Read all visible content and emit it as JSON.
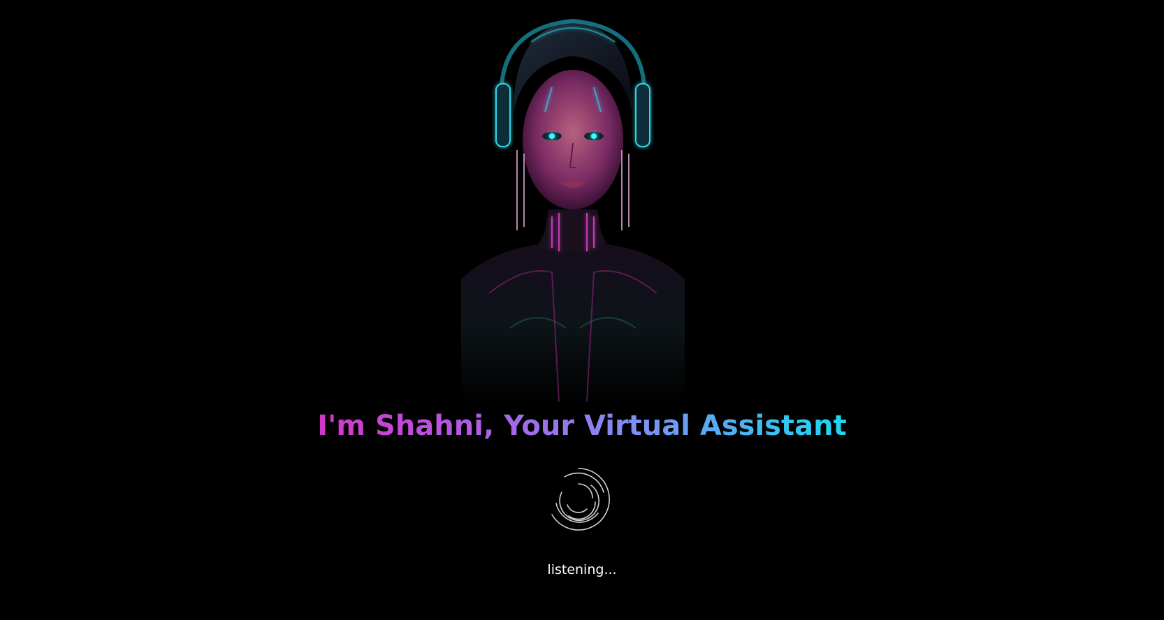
{
  "assistant": {
    "heading": "I'm Shahni, Your Virtual Assistant",
    "status": "listening..."
  },
  "icons": {
    "avatar": "cyberpunk-woman-avatar",
    "loader": "listening-spinner-icon"
  },
  "colors": {
    "background": "#000000",
    "gradient_start": "#d535c8",
    "gradient_mid": "#8b80ee",
    "gradient_end": "#19d9f0",
    "status_text": "#ffffff"
  }
}
